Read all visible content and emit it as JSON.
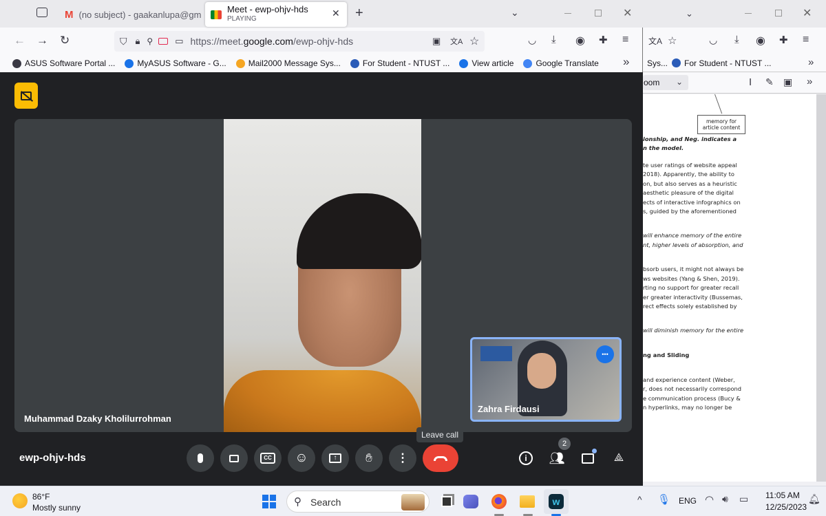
{
  "browser": {
    "tabs": [
      {
        "title": "(no subject) - gaakanlupa@gm"
      },
      {
        "title": "Meet - ewp-ohjv-hds",
        "subtitle": "PLAYING"
      }
    ],
    "new_tab_symbol": "+",
    "url_prefix": "https://meet.",
    "url_domain": "google.com",
    "url_path": "/ewp-ohjv-hds",
    "bookmarks": [
      {
        "label": "ASUS Software Portal ...",
        "icon": "globe-icon"
      },
      {
        "label": "MyASUS Software - G...",
        "icon": "asus-icon"
      },
      {
        "label": "Mail2000 Message Sys...",
        "icon": "mail-icon"
      },
      {
        "label": "For Student - NTUST ...",
        "icon": "ntust-icon"
      },
      {
        "label": "View article",
        "icon": "article-icon"
      },
      {
        "label": "Google Translate",
        "icon": "translate-icon"
      }
    ],
    "overflow_symbol": "»"
  },
  "meet": {
    "main_participant": "Muhammad Dzaky Kholilurrohman",
    "self_participant": "Zahra Firdausi",
    "meeting_code": "ewp-ohjv-hds",
    "tooltip": "Leave call",
    "people_count": "2",
    "more_symbol": "•••"
  },
  "background_window": {
    "bookmarks": [
      "Sys...",
      "For Student - NTUST ..."
    ],
    "zoom_label": "oom",
    "diagram_box": "memory for\narticle content",
    "pdf_lines": [
      {
        "text": "ionship, and Neg. indicates a",
        "style": "bi"
      },
      {
        "text": "n the model.",
        "style": "bi"
      },
      {
        "text": "te user ratings of website appeal",
        "style": ""
      },
      {
        "text": "2018). Apparently, the ability to",
        "style": ""
      },
      {
        "text": "on, but also serves as a heuristic",
        "style": ""
      },
      {
        "text": "aesthetic pleasure of the digital",
        "style": ""
      },
      {
        "text": "ects of interactive infographics on",
        "style": ""
      },
      {
        "text": "s, guided by the aforementioned",
        "style": ""
      },
      {
        "text": "will enhance memory of the entire",
        "style": "i"
      },
      {
        "text": "nt, higher levels of absorption, and",
        "style": "i"
      },
      {
        "text": "bsorb users, it might not always be",
        "style": ""
      },
      {
        "text": "ws websites (Yang & Shen, 2019).",
        "style": ""
      },
      {
        "text": "rting no support for greater recall",
        "style": ""
      },
      {
        "text": "er greater interactivity (Bussemas,",
        "style": ""
      },
      {
        "text": "rect effects solely established by",
        "style": ""
      },
      {
        "text": "will diminish memory for the entire",
        "style": "i"
      },
      {
        "text": "ng and Sliding",
        "style": "b"
      },
      {
        "text": " and experience content (Weber,",
        "style": ""
      },
      {
        "text": "r, does not necessarily correspond",
        "style": ""
      },
      {
        "text": "e communication process (Bucy &",
        "style": ""
      },
      {
        "text": "n hyperlinks, may no longer be",
        "style": ""
      }
    ]
  },
  "taskbar": {
    "weather_temp": "86°F",
    "weather_desc": "Mostly sunny",
    "search_placeholder": "Search",
    "language": "ENG",
    "time": "11:05 AM",
    "date": "12/25/2023"
  },
  "colors": {
    "meet_bg": "#202124",
    "leave_red": "#ea4335",
    "accent_yellow": "#fbbc04",
    "pip_border": "#8ab4f8",
    "more_blue": "#1a73e8"
  }
}
